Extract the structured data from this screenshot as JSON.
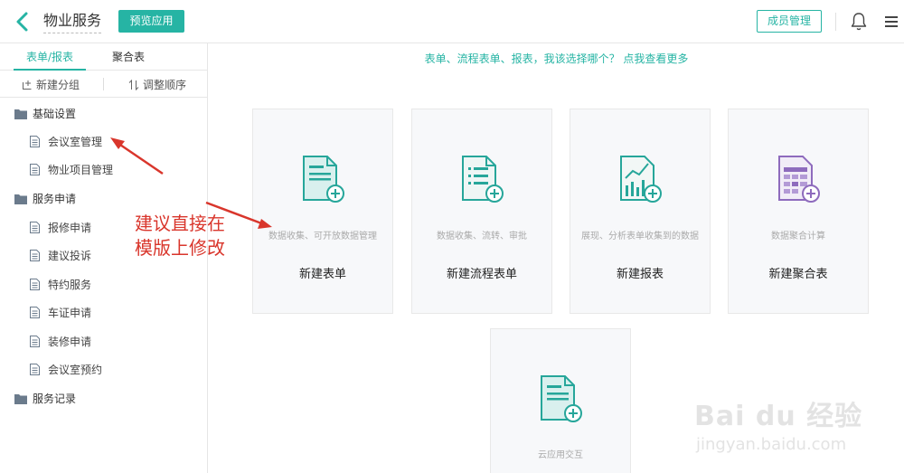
{
  "header": {
    "title": "物业服务",
    "preview_label": "预览应用",
    "member_label": "成员管理",
    "accent_color": "#26b4a4"
  },
  "sidebar": {
    "tabs": [
      {
        "label": "表单/报表",
        "active": true
      },
      {
        "label": "聚合表",
        "active": false
      }
    ],
    "actions": {
      "new_group": "新建分组",
      "reorder": "调整顺序"
    },
    "groups": [
      {
        "label": "基础设置",
        "items": [
          "会议室管理",
          "物业项目管理"
        ]
      },
      {
        "label": "服务申请",
        "items": [
          "报修申请",
          "建议投诉",
          "特约服务",
          "车证申请",
          "装修申请",
          "会议室预约"
        ]
      },
      {
        "label": "服务记录",
        "items": []
      }
    ]
  },
  "main": {
    "hint": "表单、流程表单、报表，我该选择哪个？ 点我查看更多",
    "cards": [
      {
        "desc": "数据收集、可开放数据管理",
        "title": "新建表单",
        "icon": "form-plus-icon"
      },
      {
        "desc": "数据收集、流转、审批",
        "title": "新建流程表单",
        "icon": "workflow-form-plus-icon"
      },
      {
        "desc": "展现、分析表单收集到的数据",
        "title": "新建报表",
        "icon": "report-chart-plus-icon"
      },
      {
        "desc": "数据聚合计算",
        "title": "新建聚合表",
        "icon": "aggregate-table-plus-icon"
      },
      {
        "desc": "云应用交互",
        "title": "",
        "icon": "cloud-app-plus-icon"
      }
    ]
  },
  "annotation": {
    "text": "建议直接在\n模版上修改",
    "color": "#d9362c"
  },
  "watermark": {
    "logo": "Bai du 经验",
    "url": "jingyan.baidu.com"
  }
}
